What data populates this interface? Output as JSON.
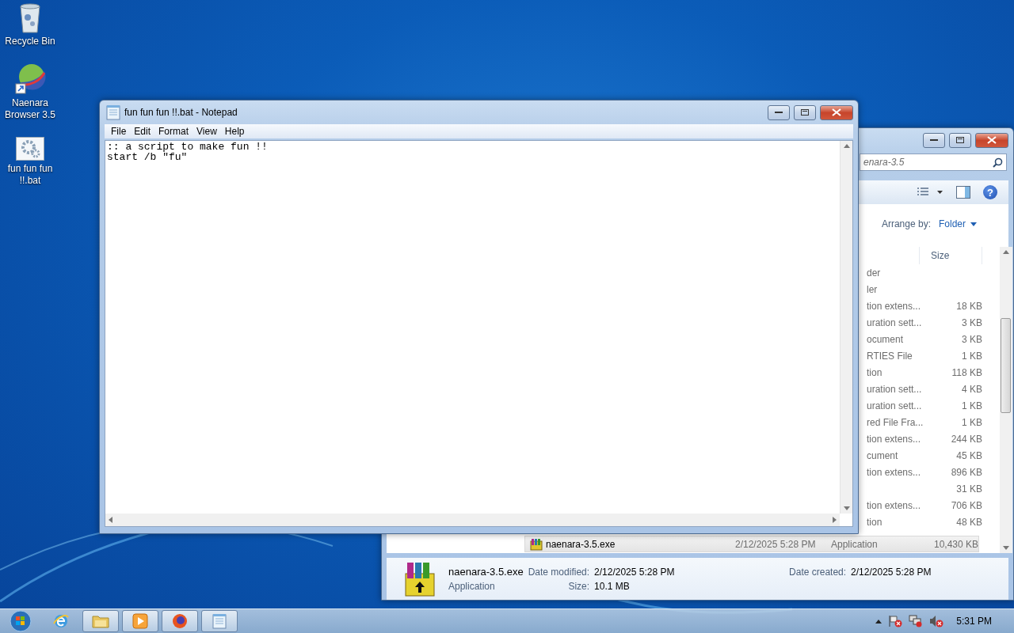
{
  "desktop_icons": [
    {
      "kind": "recycle-bin",
      "label": "Recycle Bin"
    },
    {
      "kind": "browser",
      "label": "Naenara Browser 3.5"
    },
    {
      "kind": "batch-file",
      "label": "fun fun fun !!.bat"
    }
  ],
  "explorer": {
    "search_text": "enara-3.5",
    "help_label": "?",
    "arrange_label": "Arrange by:",
    "arrange_value": "Folder",
    "size_header": "Size",
    "rows": [
      {
        "type": "der",
        "selected": false
      },
      {
        "type": "ler",
        "selected": false
      },
      {
        "type": "tion extens...",
        "size": "18 KB",
        "selected": false
      },
      {
        "type": "uration sett...",
        "size": "3 KB",
        "selected": false
      },
      {
        "type": "ocument",
        "size": "3 KB",
        "selected": false
      },
      {
        "type": "RTIES File",
        "size": "1 KB",
        "selected": false
      },
      {
        "type": "tion",
        "size": "118 KB",
        "selected": false
      },
      {
        "type": "uration sett...",
        "size": "4 KB",
        "selected": false
      },
      {
        "type": "uration sett...",
        "size": "1 KB",
        "selected": false
      },
      {
        "type": "red File Fra...",
        "size": "1 KB",
        "selected": false
      },
      {
        "type": "tion extens...",
        "size": "244 KB",
        "selected": false
      },
      {
        "type": "cument",
        "size": "45 KB",
        "selected": false
      },
      {
        "type": "tion extens...",
        "size": "896 KB",
        "selected": false
      },
      {
        "size": "31 KB",
        "selected": false
      },
      {
        "type": "tion extens...",
        "size": "706 KB",
        "selected": false
      },
      {
        "type": "tion",
        "size": "48 KB",
        "selected": false
      },
      {
        "name": "naenara-3.5.exe",
        "date": "2/12/2025 5:28 PM",
        "type": "Application",
        "size": "10,430 KB",
        "selected": true
      }
    ],
    "details": {
      "name": "naenara-3.5.exe",
      "type": "Application",
      "modified_label": "Date modified:",
      "modified": "2/12/2025 5:28 PM",
      "created_label": "Date created:",
      "created": "2/12/2025 5:28 PM",
      "size_label": "Size:",
      "size": "10.1 MB"
    }
  },
  "notepad": {
    "title": "fun fun fun !!.bat - Notepad",
    "menu": [
      "File",
      "Edit",
      "Format",
      "View",
      "Help"
    ],
    "lines": [
      ":: a script to make fun !!",
      "start /b \"fu\""
    ]
  },
  "taskbar": {
    "items": [
      {
        "kind": "ie",
        "running": false
      },
      {
        "kind": "folder",
        "running": true
      },
      {
        "kind": "media",
        "running": true
      },
      {
        "kind": "firefox",
        "running": true
      },
      {
        "kind": "notepad",
        "running": true
      }
    ],
    "clock": "5:31 PM"
  }
}
